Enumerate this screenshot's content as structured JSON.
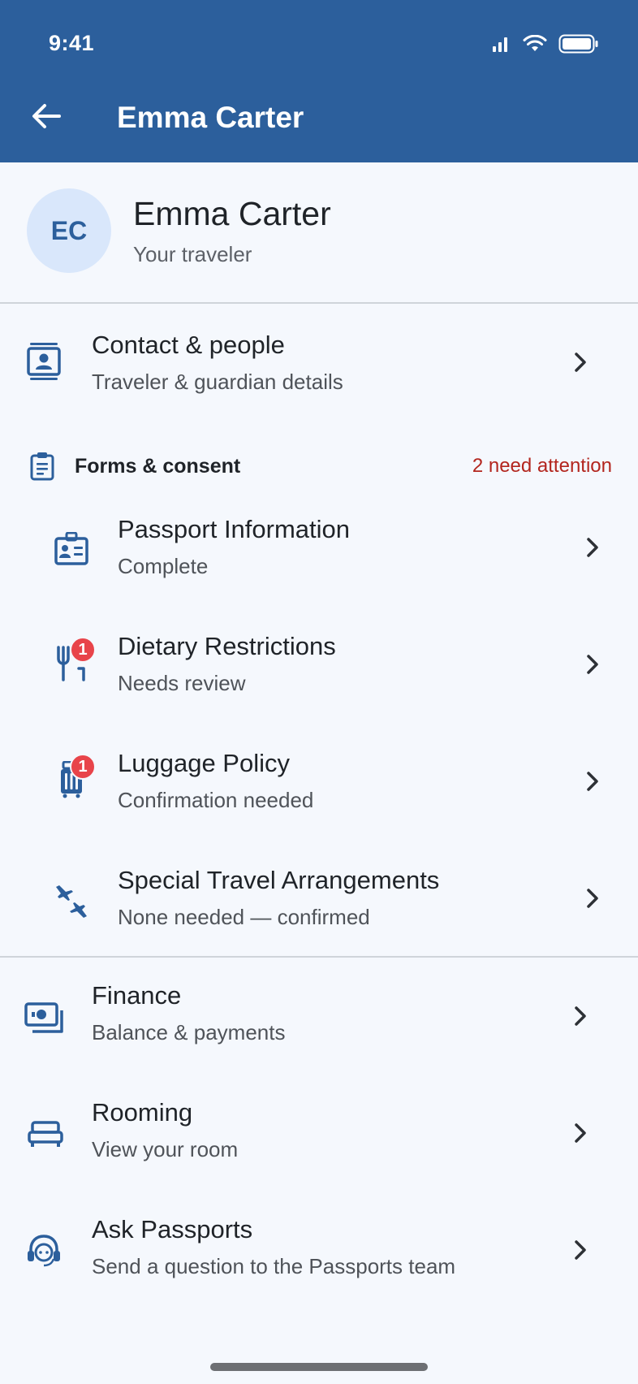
{
  "status_bar": {
    "time": "9:41"
  },
  "appbar": {
    "title": "Emma Carter"
  },
  "profile": {
    "initials": "EC",
    "name": "Emma Carter",
    "subtitle": "Your traveler"
  },
  "contact": {
    "title": "Contact & people",
    "subtitle": "Traveler & guardian details"
  },
  "forms": {
    "label": "Forms & consent",
    "attention": "2 need attention",
    "items": [
      {
        "title": "Passport Information",
        "subtitle": "Complete",
        "badge": ""
      },
      {
        "title": "Dietary Restrictions",
        "subtitle": "Needs review",
        "badge": "1"
      },
      {
        "title": "Luggage Policy",
        "subtitle": "Confirmation needed",
        "badge": "1"
      },
      {
        "title": "Special Travel Arrangements",
        "subtitle": "None needed — confirmed",
        "badge": ""
      }
    ]
  },
  "menu": [
    {
      "title": "Finance",
      "subtitle": "Balance & payments"
    },
    {
      "title": "Rooming",
      "subtitle": "View your room"
    },
    {
      "title": "Ask Passports",
      "subtitle": "Send a question to the Passports team"
    }
  ],
  "colors": {
    "primary": "#2c5f9c",
    "attention": "#b3261e",
    "badge": "#e8444a",
    "background": "#f5f8fd"
  }
}
